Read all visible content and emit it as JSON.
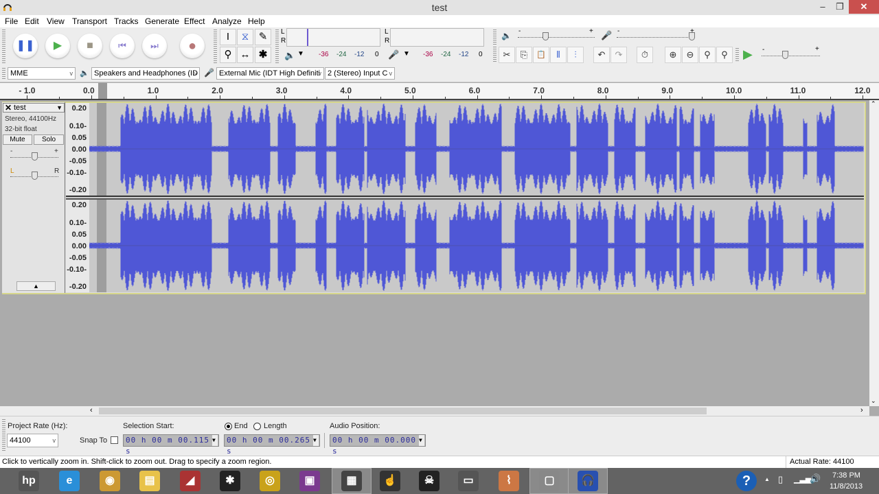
{
  "window": {
    "title": "test",
    "app_icon": "headphones-icon",
    "controls": {
      "minimize": "–",
      "restore": "❐",
      "close": "✕"
    }
  },
  "menu": [
    "File",
    "Edit",
    "View",
    "Transport",
    "Tracks",
    "Generate",
    "Effect",
    "Analyze",
    "Help"
  ],
  "transport": {
    "buttons": [
      {
        "name": "pause",
        "icon": "pause-icon",
        "glyph": "❚❚",
        "color": "#3b62d0"
      },
      {
        "name": "play",
        "icon": "play-icon",
        "glyph": "▶",
        "color": "#4cb04c"
      },
      {
        "name": "stop",
        "icon": "stop-icon",
        "glyph": "■",
        "color": "#9c9686"
      },
      {
        "name": "skip-start",
        "icon": "skip-start-icon",
        "glyph": "⏮",
        "color": "#8a7ecf"
      },
      {
        "name": "skip-end",
        "icon": "skip-end-icon",
        "glyph": "⏭",
        "color": "#8a7ecf"
      },
      {
        "name": "record",
        "icon": "record-icon",
        "glyph": "●",
        "color": "#b87878"
      }
    ]
  },
  "tools": [
    {
      "name": "selection-tool",
      "glyph": "I"
    },
    {
      "name": "envelope-tool",
      "glyph": "⧖"
    },
    {
      "name": "draw-tool",
      "glyph": "✎"
    },
    {
      "name": "zoom-tool",
      "glyph": "⚲"
    },
    {
      "name": "timeshift-tool",
      "glyph": "↔"
    },
    {
      "name": "multi-tool",
      "glyph": "✱"
    }
  ],
  "meters": {
    "playback": {
      "left_label": "L",
      "right_label": "R",
      "scale": [
        "-36",
        "-24",
        "-12",
        "0"
      ]
    },
    "record": {
      "left_label": "L",
      "right_label": "R",
      "scale": [
        "-36",
        "-24",
        "-12",
        "0"
      ]
    }
  },
  "mixer": {
    "playback_volume": {
      "minus": "-",
      "plus": "+",
      "value": 0.35
    },
    "recording_volume": {
      "minus": "-",
      "plus": "+",
      "value": 1.0
    }
  },
  "edit_tools": [
    {
      "name": "trim-outside",
      "glyph": "✂"
    },
    {
      "name": "copy",
      "glyph": "⎘"
    },
    {
      "name": "paste",
      "glyph": "📋"
    },
    {
      "name": "trim",
      "glyph": "⫴"
    },
    {
      "name": "silence",
      "glyph": "⫶"
    },
    {
      "name": "undo",
      "glyph": "↶"
    },
    {
      "name": "redo",
      "glyph": "↷"
    },
    {
      "name": "sync-lock",
      "glyph": "⏱"
    },
    {
      "name": "zoom-in",
      "glyph": "⊕"
    },
    {
      "name": "zoom-out",
      "glyph": "⊖"
    },
    {
      "name": "fit-selection",
      "glyph": "⚲"
    },
    {
      "name": "fit-project",
      "glyph": "⚲"
    }
  ],
  "play_at_speed": {
    "glyph": "▶",
    "minus": "-",
    "plus": "+",
    "value": 0.4
  },
  "devices": {
    "host": "MME",
    "output": "Speakers and Headphones (ID",
    "input": "External Mic (IDT High Definiti",
    "channels": "2 (Stereo) Input C"
  },
  "ruler": {
    "labels": [
      "- 1.0",
      "0.0",
      "1.0",
      "2.0",
      "3.0",
      "4.0",
      "5.0",
      "6.0",
      "7.0",
      "8.0",
      "9.0",
      "10.0",
      "11.0",
      "12.0"
    ]
  },
  "track": {
    "name": "test",
    "format": "Stereo, 44100Hz",
    "bitdepth": "32-bit float",
    "mute": "Mute",
    "solo": "Solo",
    "gain": {
      "minus": "-",
      "plus": "+",
      "value": 0.5
    },
    "pan": {
      "left": "L",
      "right": "R",
      "value": 0.5
    },
    "collapse": "▲",
    "vruler_labels": [
      "0.20",
      "0.10-",
      "0.05",
      "0.00",
      "-0.05",
      "-0.10-",
      "-0.20"
    ],
    "wave_color": "#4f57d6",
    "selection": {
      "start_s": 0.115,
      "end_s": 0.265
    }
  },
  "selection_toolbar": {
    "project_rate_label": "Project Rate (Hz):",
    "project_rate": "44100",
    "snap_to": "Snap To",
    "snap_checked": false,
    "selection_start_label": "Selection Start:",
    "end_label": "End",
    "length_label": "Length",
    "end_selected": true,
    "audio_position_label": "Audio Position:",
    "selection_start": "00 h 00 m 00.115 s",
    "selection_end": "00 h 00 m 00.265 s",
    "audio_position": "00 h 00 m 00.000 s"
  },
  "status": {
    "message": "Click to vertically zoom in. Shift-click to zoom out. Drag to specify a zoom region.",
    "actual_rate": "Actual Rate: 44100"
  },
  "taskbar": {
    "apps": [
      {
        "name": "hp",
        "glyph": "hp",
        "color": "#555"
      },
      {
        "name": "internet-explorer",
        "glyph": "e",
        "color": "#2a8fd8"
      },
      {
        "name": "chrome",
        "glyph": "◉",
        "color": "#c93"
      },
      {
        "name": "file-explorer",
        "glyph": "▤",
        "color": "#e8c24a"
      },
      {
        "name": "app-5",
        "glyph": "◢",
        "color": "#a33"
      },
      {
        "name": "app-6",
        "glyph": "✱",
        "color": "#222"
      },
      {
        "name": "app-7",
        "glyph": "◎",
        "color": "#c9a21a"
      },
      {
        "name": "app-8",
        "glyph": "▣",
        "color": "#7b3a8f"
      },
      {
        "name": "app-9",
        "glyph": "▦",
        "color": "#444"
      },
      {
        "name": "app-10",
        "glyph": "☝",
        "color": "#333"
      },
      {
        "name": "app-11",
        "glyph": "☠",
        "color": "#222"
      },
      {
        "name": "app-12",
        "glyph": "▭",
        "color": "#555"
      },
      {
        "name": "ccleaner",
        "glyph": "⌇",
        "color": "#c74"
      },
      {
        "name": "app-14",
        "glyph": "▢",
        "color": "#888"
      },
      {
        "name": "audacity",
        "glyph": "🎧",
        "color": "#2850b0"
      }
    ],
    "help": "?",
    "tray_arrow": "▲",
    "time": "7:38 PM",
    "date": "11/8/2013"
  }
}
